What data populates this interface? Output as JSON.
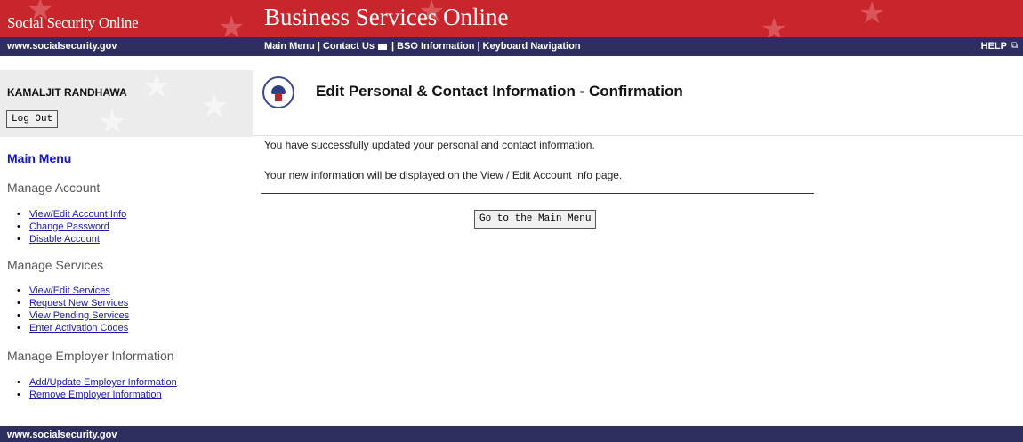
{
  "banner": {
    "site_name": "Social Security Online",
    "app_title": "Business Services Online"
  },
  "navbar": {
    "url": "www.socialsecurity.gov",
    "links": [
      "Main Menu",
      "Contact Us",
      "BSO Information",
      "Keyboard Navigation"
    ],
    "help": "HELP"
  },
  "user": {
    "name": "KAMALJIT RANDHAWA",
    "logout_label": "Log Out"
  },
  "page": {
    "title": "Edit Personal & Contact Information - Confirmation"
  },
  "sidebar": {
    "main_menu": "Main Menu",
    "sections": [
      {
        "heading": "Manage Account",
        "items": [
          "View/Edit Account Info",
          "Change Password",
          "Disable Account"
        ]
      },
      {
        "heading": "Manage Services",
        "items": [
          "View/Edit Services",
          "Request New Services",
          "View Pending Services",
          "Enter Activation Codes"
        ]
      },
      {
        "heading": "Manage Employer Information",
        "items": [
          "Add/Update Employer Information",
          "Remove Employer Information"
        ]
      }
    ]
  },
  "content": {
    "message_1": "You have successfully updated your personal and contact information.",
    "message_2": "Your new information will be displayed on the View / Edit Account Info page.",
    "main_menu_button": "Go to the Main Menu"
  },
  "footer": {
    "url": "www.socialsecurity.gov"
  },
  "colors": {
    "banner": "#c8262c",
    "navbar": "#2e2f5e",
    "link": "#1a1aa8"
  }
}
